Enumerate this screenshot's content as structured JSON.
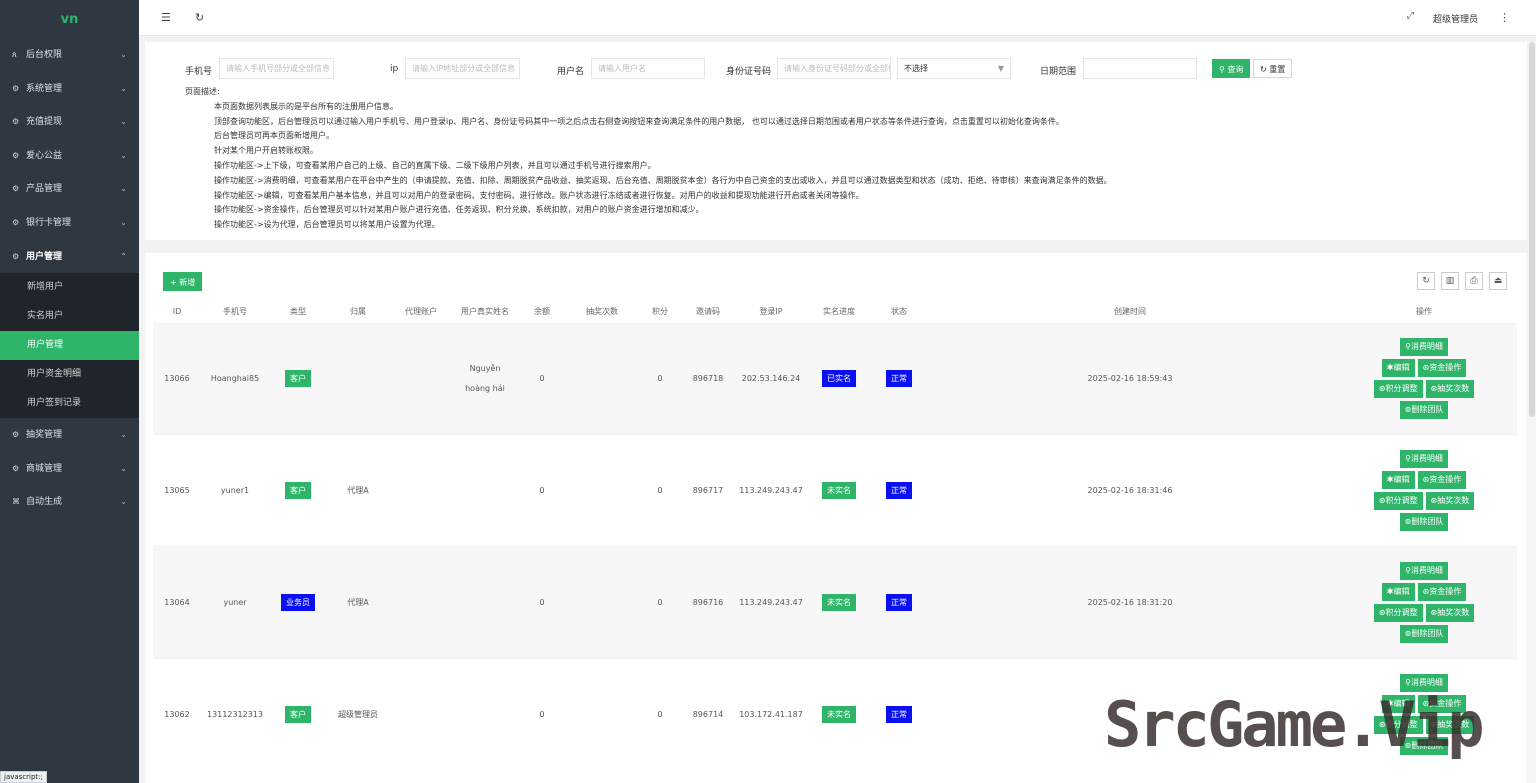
{
  "app": {
    "logo": "vn"
  },
  "sidebar": {
    "items": [
      {
        "label": "后台权限",
        "icon": "person-icon"
      },
      {
        "label": "系统管理",
        "icon": "gear-icon"
      },
      {
        "label": "充值提现",
        "icon": "gear-icon"
      },
      {
        "label": "爱心公益",
        "icon": "gear-icon"
      },
      {
        "label": "产品管理",
        "icon": "gear-icon"
      },
      {
        "label": "银行卡管理",
        "icon": "gear-icon"
      },
      {
        "label": "用户管理",
        "icon": "gear-icon"
      },
      {
        "label": "抽奖管理",
        "icon": "gear-icon"
      },
      {
        "label": "商城管理",
        "icon": "gear-icon"
      },
      {
        "label": "自动生成",
        "icon": "code-icon"
      }
    ],
    "sub_items": [
      "新增用户",
      "实名用户",
      "用户管理",
      "用户资金明细",
      "用户签到记录"
    ],
    "active_sub": "用户管理"
  },
  "topbar": {
    "user": "超级管理员"
  },
  "search": {
    "phone_label": "手机号",
    "phone_placeholder": "请输入手机号部分或全部信息",
    "ip_label": "ip",
    "ip_placeholder": "请输入IP地址部分或全部信息",
    "username_label": "用户名",
    "username_placeholder": "请输入用户名",
    "idcard_label": "身份证号码",
    "idcard_placeholder": "请输入身份证号码部分或全部信息",
    "select_value": "不选择",
    "date_label": "日期范围",
    "query_btn": "查询",
    "reset_btn": "重置"
  },
  "description": {
    "title": "页面描述:",
    "lines": [
      "本页面数据列表展示的是平台所有的注册用户信息。",
      "顶部查询功能区，后台管理员可以通过输入用户手机号、用户登录ip、用户名、身份证号码其中一项之后点击右侧查询按钮来查询满足条件的用户数据， 也可以通过选择日期范围或者用户状态等条件进行查询，点击重置可以初始化查询条件。",
      "后台管理员可再本页面新增用户。",
      "针对某个用户开启转账权限。",
      "操作功能区->上下级，可查看某用户自己的上级、自己的直属下级、二级下级用户列表，并且可以通过手机号进行搜索用户。",
      "操作功能区->消费明细，可查看某用户在平台中产生的（申请提款、充值、扣除、周期脱贫产品收益、抽奖返现、后台充值、周期脱贫本金）各行为中自己资金的支出或收入，并且可以通过数据类型和状态（成功、拒绝、待审核）来查询满足条件的数据。",
      "操作功能区->编辑，可查看某用户基本信息，并且可以对用户的登录密码、支付密码、进行修改。账户状态进行冻结或者进行恢复。对用户的收益和提现功能进行开启或者关闭等操作。",
      "操作功能区->资金操作，后台管理员可以针对某用户账户进行充值、任务返现、积分兑换、系统扣款，对用户的账户资金进行增加和减少。",
      "操作功能区->设为代理，后台管理员可以将某用户设置为代理。"
    ]
  },
  "table": {
    "add_btn": "+ 新增",
    "headers": [
      "ID",
      "手机号",
      "类型",
      "归属",
      "代理账户",
      "用户真实姓名",
      "余额",
      "抽奖次数",
      "积分",
      "邀请码",
      "登录IP",
      "实名进度",
      "状态",
      "创建时间",
      "操作"
    ],
    "ops": {
      "consume": "消费明细",
      "edit": "编辑",
      "fund": "资金操作",
      "points": "积分调整",
      "lottery": "抽奖次数",
      "del_team": "删除团队"
    },
    "rows": [
      {
        "id": "13066",
        "phone": "Hoanghai85",
        "type": "客户",
        "type_color": "green",
        "belong": "",
        "agent": "",
        "real_name_1": "Nguyễn",
        "real_name_2": "hoàng hải",
        "balance": "0",
        "lottery": "",
        "points": "0",
        "invite": "896718",
        "ip": "202.53.146.24",
        "verify": "已实名",
        "verify_color": "blue",
        "status": "正常",
        "created": "2025-02-16 18:59:43"
      },
      {
        "id": "13065",
        "phone": "yuner1",
        "type": "客户",
        "type_color": "green",
        "belong": "代理A",
        "agent": "",
        "real_name_1": "",
        "real_name_2": "",
        "balance": "0",
        "lottery": "",
        "points": "0",
        "invite": "896717",
        "ip": "113.249.243.47",
        "verify": "未实名",
        "verify_color": "green",
        "status": "正常",
        "created": "2025-02-16 18:31:46"
      },
      {
        "id": "13064",
        "phone": "yuner",
        "type": "业务员",
        "type_color": "blue",
        "belong": "代理A",
        "agent": "",
        "real_name_1": "",
        "real_name_2": "",
        "balance": "0",
        "lottery": "",
        "points": "0",
        "invite": "896716",
        "ip": "113.249.243.47",
        "verify": "未实名",
        "verify_color": "green",
        "status": "正常",
        "created": "2025-02-16 18:31:20"
      },
      {
        "id": "13062",
        "phone": "13112312313",
        "type": "客户",
        "type_color": "green",
        "belong": "超级管理员",
        "agent": "",
        "real_name_1": "",
        "real_name_2": "",
        "balance": "0",
        "lottery": "",
        "points": "0",
        "invite": "896714",
        "ip": "103.172.41.187",
        "verify": "未实名",
        "verify_color": "green",
        "status": "正常",
        "created": ""
      }
    ]
  },
  "statusbar": "javascript:;",
  "watermark": "SrcGame.Vip"
}
